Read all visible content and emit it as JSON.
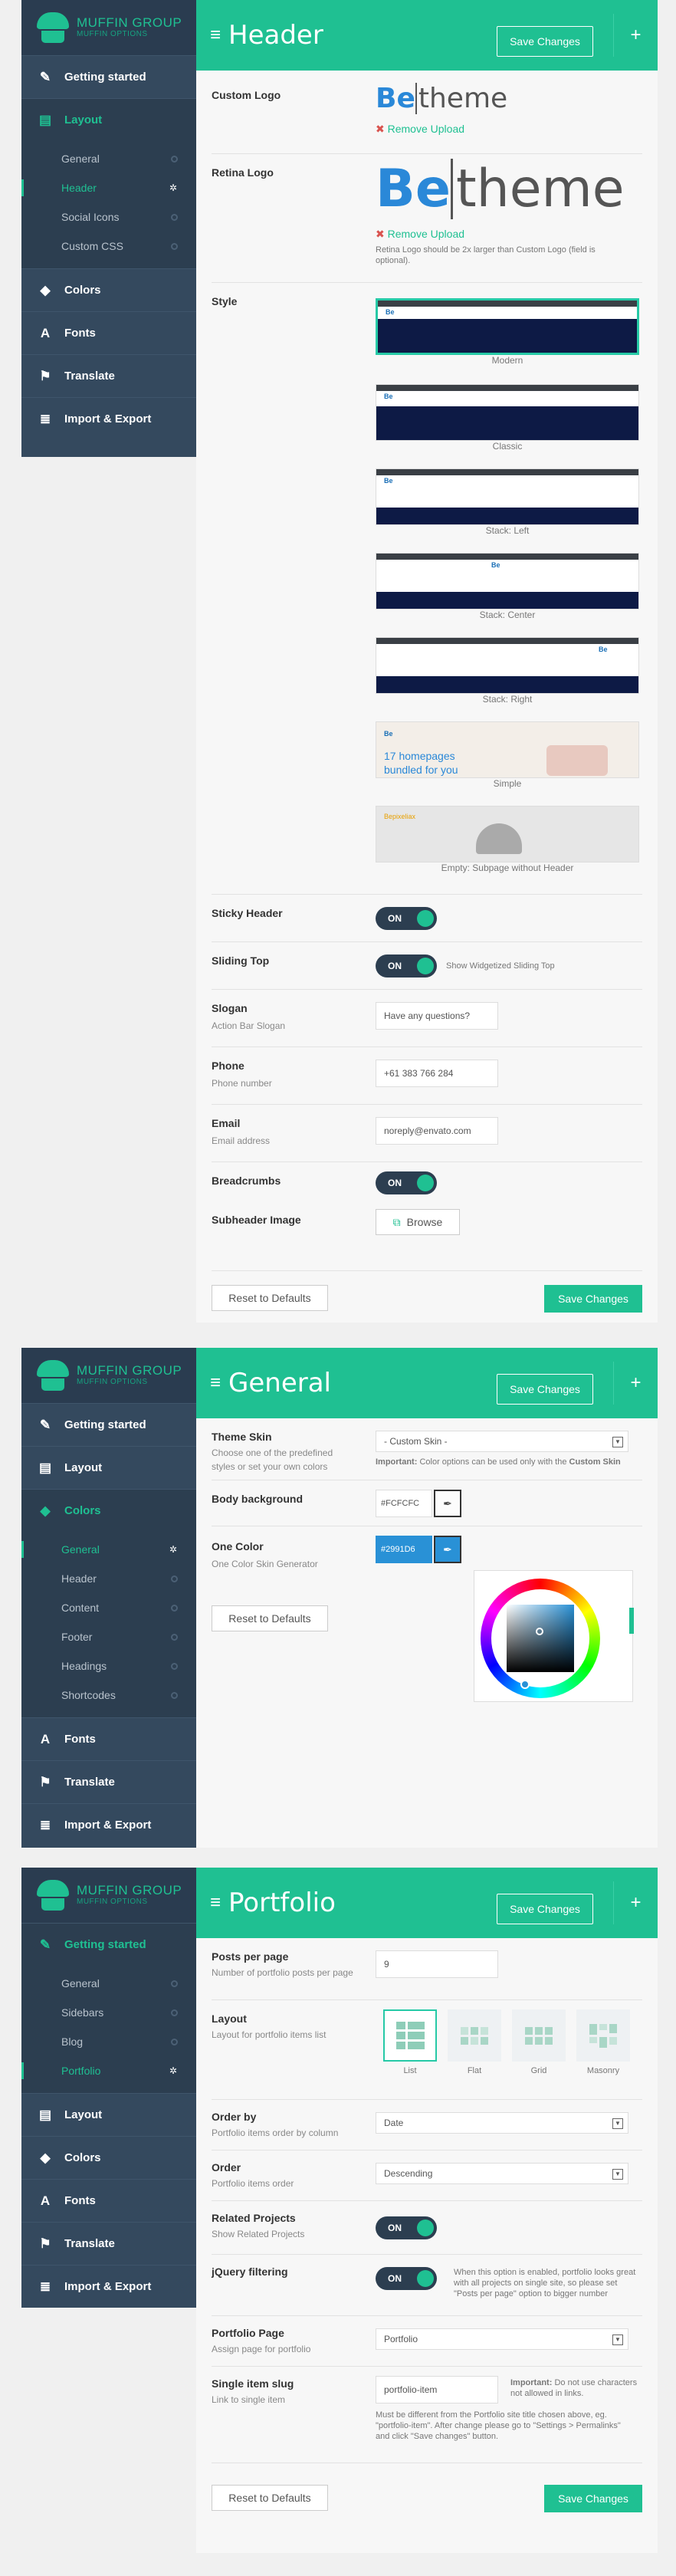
{
  "brand": {
    "name": "MUFFIN GROUP",
    "tagline": "MUFFIN OPTIONS"
  },
  "save_label": "Save Changes",
  "plus_label": "+",
  "reset_label": "Reset to Defaults",
  "on_label": "ON",
  "colors": {
    "accent": "#1fc092",
    "sidebar": "#34495e",
    "sidebar_dark": "#2c3e50",
    "hero": "#0d1a45"
  },
  "panel1": {
    "title": "Header",
    "sidebar": {
      "getting_started": "Getting started",
      "layout": "Layout",
      "subs": [
        "General",
        "Header",
        "Social Icons",
        "Custom CSS"
      ],
      "colors": "Colors",
      "fonts": "Fonts",
      "translate": "Translate",
      "import_export": "Import & Export"
    },
    "custom_logo": {
      "label": "Custom Logo",
      "remove": "Remove Upload"
    },
    "logo_text": {
      "be": "Be",
      "theme": "theme"
    },
    "retina_logo": {
      "label": "Retina Logo",
      "remove": "Remove Upload",
      "note": "Retina Logo should be 2x larger than Custom Logo (field is optional)."
    },
    "style": {
      "label": "Style",
      "options": [
        "Modern",
        "Classic",
        "Stack: Left",
        "Stack: Center",
        "Stack: Right",
        "Simple",
        "Empty: Subpage without Header"
      ],
      "simple_text": "17 homepages",
      "simple_text2": "bundled for you",
      "empty_logo": "Bepixeliax"
    },
    "sticky": {
      "label": "Sticky Header"
    },
    "sliding": {
      "label": "Sliding Top",
      "note": "Show Widgetized Sliding Top"
    },
    "slogan": {
      "label": "Slogan",
      "desc": "Action Bar Slogan",
      "value": "Have any questions?"
    },
    "phone": {
      "label": "Phone",
      "desc": "Phone number",
      "value": "+61 383 766 284"
    },
    "email": {
      "label": "Email",
      "desc": "Email address",
      "value": "noreply@envato.com"
    },
    "breadcrumbs": {
      "label": "Breadcrumbs"
    },
    "subheader": {
      "label": "Subheader Image",
      "browse": "Browse"
    }
  },
  "panel2": {
    "title": "General",
    "sidebar": {
      "getting_started": "Getting started",
      "layout": "Layout",
      "colors": "Colors",
      "subs": [
        "General",
        "Header",
        "Content",
        "Footer",
        "Headings",
        "Shortcodes"
      ],
      "fonts": "Fonts",
      "translate": "Translate",
      "import_export": "Import & Export"
    },
    "skin": {
      "label": "Theme Skin",
      "desc": "Choose one of the predefined styles or set your own colors",
      "value": "- Custom Skin -",
      "note_bold": "Important:",
      "note": "Color options can be used only with the",
      "note_end": "Custom Skin"
    },
    "body_bg": {
      "label": "Body background",
      "value": "#FCFCFC"
    },
    "one_color": {
      "label": "One Color",
      "desc": "One Color Skin Generator",
      "value": "#2991D6"
    }
  },
  "panel3": {
    "title": "Portfolio",
    "sidebar": {
      "getting_started": "Getting started",
      "subs": [
        "General",
        "Sidebars",
        "Blog",
        "Portfolio"
      ],
      "layout": "Layout",
      "colors": "Colors",
      "fonts": "Fonts",
      "translate": "Translate",
      "import_export": "Import & Export"
    },
    "posts": {
      "label": "Posts per page",
      "desc": "Number of portfolio posts per page",
      "value": "9"
    },
    "layout": {
      "label": "Layout",
      "desc": "Layout for portfolio items list",
      "options": [
        "List",
        "Flat",
        "Grid",
        "Masonry"
      ]
    },
    "orderby": {
      "label": "Order by",
      "desc": "Portfolio items order by column",
      "value": "Date"
    },
    "order": {
      "label": "Order",
      "desc": "Portfolio items order",
      "value": "Descending"
    },
    "related": {
      "label": "Related Projects",
      "desc": "Show Related Projects"
    },
    "jquery": {
      "label": "jQuery filtering",
      "note": "When this option is enabled, portfolio looks great with all projects on single site, so please set \"Posts per page\" option to bigger number"
    },
    "page": {
      "label": "Portfolio Page",
      "desc": "Assign page for portfolio",
      "value": "Portfolio"
    },
    "slug": {
      "label": "Single item slug",
      "desc": "Link to single item",
      "value": "portfolio-item",
      "note_bold": "Important:",
      "note": "Do not use characters not allowed in links.",
      "note2": "Must be different from the Portfolio site title chosen above, eg. \"portfolio-item\". After change please go to \"Settings > Permalinks\" and click \"Save changes\" button."
    }
  }
}
